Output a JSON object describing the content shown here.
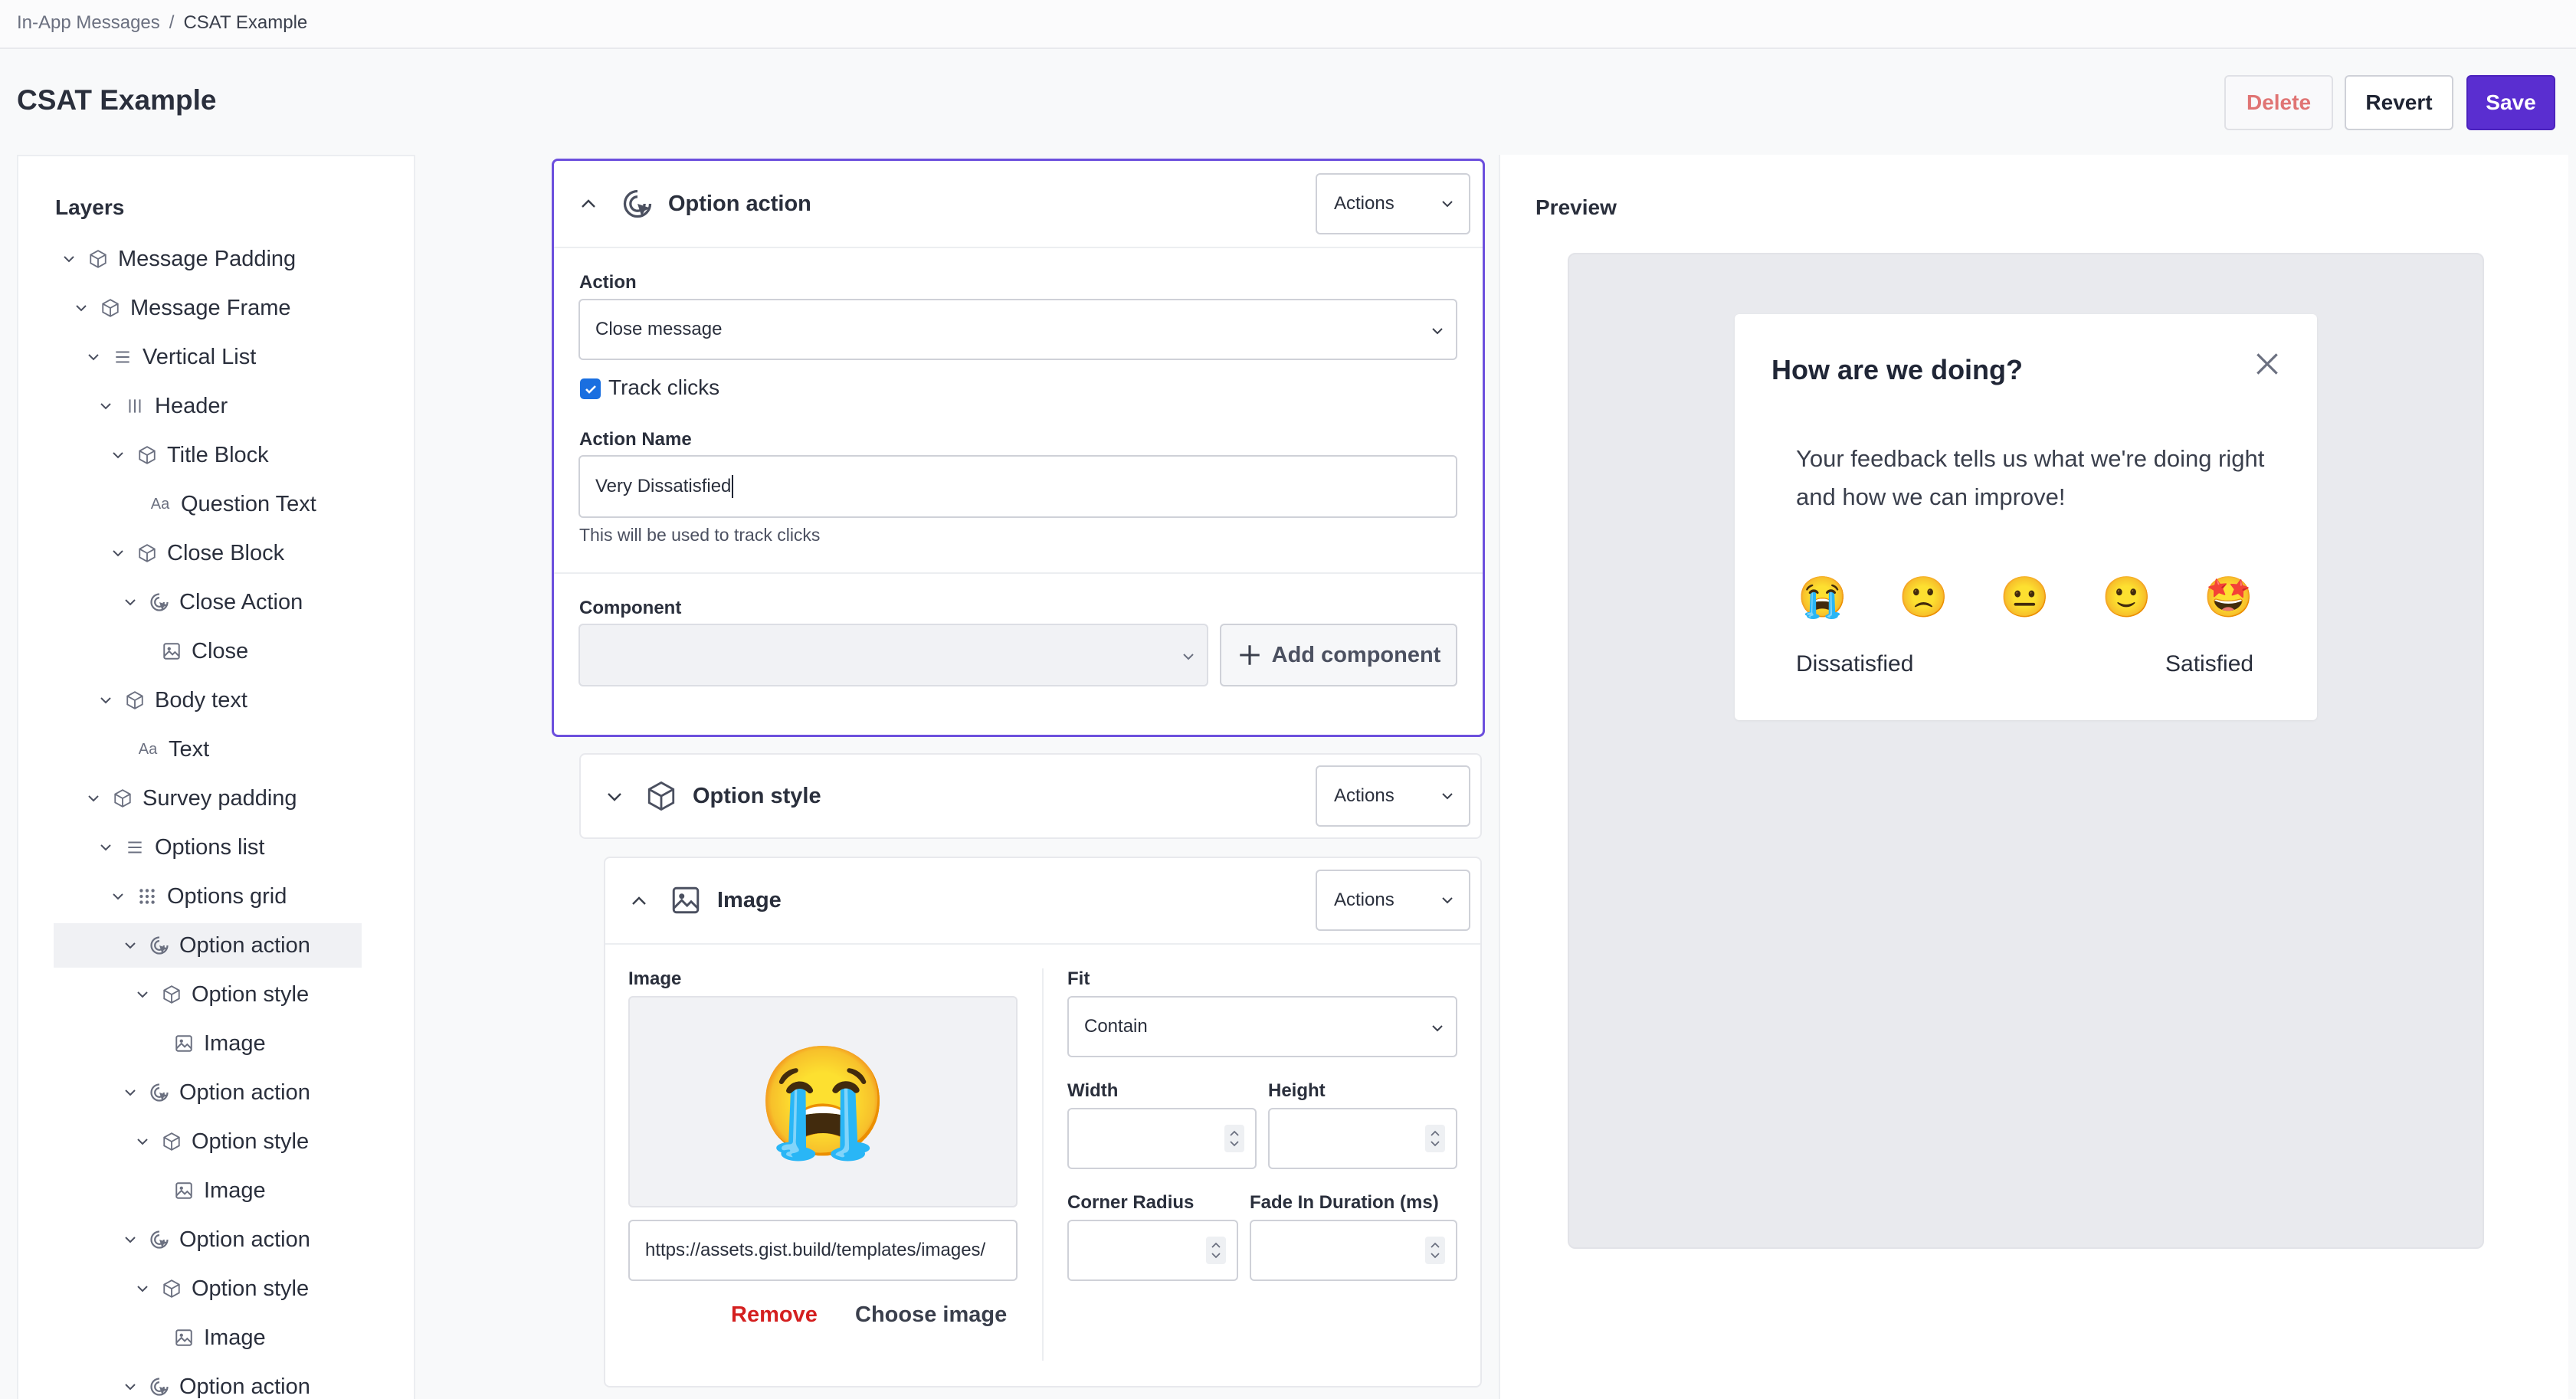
{
  "breadcrumb": {
    "parent": "In-App Messages",
    "separator": "/",
    "current": "CSAT Example"
  },
  "page": {
    "title": "CSAT Example"
  },
  "header_actions": {
    "delete": "Delete",
    "revert": "Revert",
    "save": "Save"
  },
  "colors": {
    "accent": "#5a2ed0",
    "danger": "#d41f1f",
    "selected_border": "#6c4fdd"
  },
  "layers": {
    "heading": "Layers",
    "items": [
      {
        "label": "Message Padding",
        "icon": "cube-icon",
        "chevron": "down"
      },
      {
        "label": "Message Frame",
        "icon": "cube-icon",
        "chevron": "down"
      },
      {
        "label": "Vertical List",
        "icon": "list-icon",
        "chevron": "down"
      },
      {
        "label": "Header",
        "icon": "columns-icon",
        "chevron": "down"
      },
      {
        "label": "Title Block",
        "icon": "cube-icon",
        "chevron": "down"
      },
      {
        "label": "Question Text",
        "icon": "text-icon",
        "chevron": "none"
      },
      {
        "label": "Close Block",
        "icon": "cube-icon",
        "chevron": "down"
      },
      {
        "label": "Close Action",
        "icon": "click-icon",
        "chevron": "down"
      },
      {
        "label": "Close",
        "icon": "image-icon",
        "chevron": "none"
      },
      {
        "label": "Body text",
        "icon": "cube-icon",
        "chevron": "down"
      },
      {
        "label": "Text",
        "icon": "text-icon",
        "chevron": "none"
      },
      {
        "label": "Survey padding",
        "icon": "cube-icon",
        "chevron": "down"
      },
      {
        "label": "Options list",
        "icon": "list-icon",
        "chevron": "down"
      },
      {
        "label": "Options grid",
        "icon": "grid-icon",
        "chevron": "down"
      },
      {
        "label": "Option action",
        "icon": "click-icon",
        "chevron": "down",
        "selected": true
      },
      {
        "label": "Option style",
        "icon": "cube-icon",
        "chevron": "down"
      },
      {
        "label": "Image",
        "icon": "image-icon",
        "chevron": "none"
      },
      {
        "label": "Option action",
        "icon": "click-icon",
        "chevron": "down"
      },
      {
        "label": "Option style",
        "icon": "cube-icon",
        "chevron": "down"
      },
      {
        "label": "Image",
        "icon": "image-icon",
        "chevron": "none"
      },
      {
        "label": "Option action",
        "icon": "click-icon",
        "chevron": "down"
      },
      {
        "label": "Option style",
        "icon": "cube-icon",
        "chevron": "down"
      },
      {
        "label": "Image",
        "icon": "image-icon",
        "chevron": "none"
      },
      {
        "label": "Option action",
        "icon": "click-icon",
        "chevron": "down"
      }
    ]
  },
  "option_action": {
    "title": "Option action",
    "actions_label": "Actions",
    "action_label": "Action",
    "action_value": "Close message",
    "track_clicks_label": "Track clicks",
    "track_clicks_checked": true,
    "action_name_label": "Action Name",
    "action_name_value": "Very Dissatisfied",
    "action_name_hint": "This will be used to track clicks",
    "component_label": "Component",
    "component_value": "",
    "add_component_label": "Add component"
  },
  "option_style": {
    "title": "Option style",
    "actions_label": "Actions"
  },
  "image_card": {
    "title": "Image",
    "actions_label": "Actions",
    "image_label": "Image",
    "image_emoji": "😭",
    "image_url": "https://assets.gist.build/templates/images/",
    "remove_label": "Remove",
    "choose_label": "Choose image",
    "fit_label": "Fit",
    "fit_value": "Contain",
    "width_label": "Width",
    "width_value": "",
    "height_label": "Height",
    "height_value": "",
    "corner_radius_label": "Corner Radius",
    "corner_radius_value": "",
    "fade_in_label": "Fade In Duration (ms)",
    "fade_in_value": ""
  },
  "preview": {
    "label": "Preview",
    "question": "How are we doing?",
    "body": "Your feedback tells us what we're doing right and how we can improve!",
    "options": [
      "😭",
      "🙁",
      "😐",
      "🙂",
      "🤩"
    ],
    "low_label": "Dissatisfied",
    "high_label": "Satisfied"
  }
}
